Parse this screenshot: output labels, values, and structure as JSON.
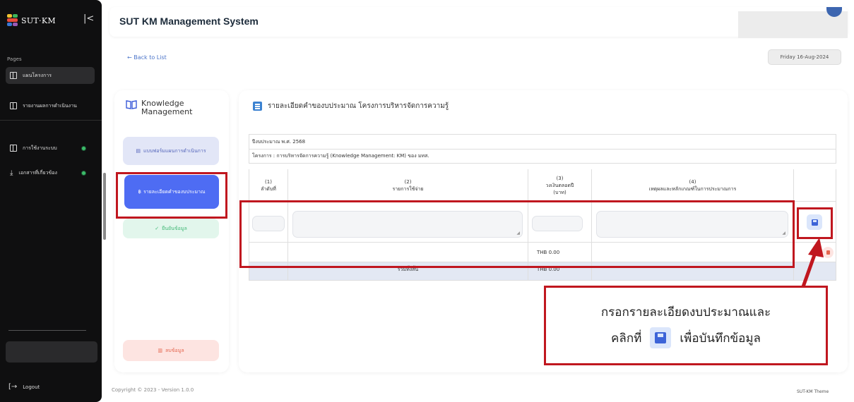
{
  "sidebar": {
    "brand": "SUT·KM",
    "collapse_glyph": "|<",
    "pages_label": "Pages",
    "items": [
      {
        "label": "แผนโครงการ",
        "icon": "table-icon"
      },
      {
        "label": "รายงานผลการดำเนินงาน",
        "icon": "document-icon"
      },
      {
        "label": "การใช้งานระบบ",
        "icon": "table-icon"
      },
      {
        "label": "เอกสารที่เกี่ยวข้อง",
        "icon": "download-icon"
      }
    ],
    "logout": "Logout"
  },
  "header": {
    "title": "SUT KM Management System"
  },
  "nav": {
    "back": "← Back to List",
    "date": "Friday 16-Aug-2024"
  },
  "left_panel": {
    "title_line1": "Knowledge",
    "title_line2": "Management",
    "form_btn": "แบบฟอร์มแผนการดำเนินการ",
    "detail_btn": "รายละเอียดคำของบประมาณ",
    "confirm_btn": "ยืนยันข้อมูล",
    "delete_btn": "ลบข้อมูล"
  },
  "main": {
    "section_title": "รายละเอียดคำของบประมาณ โครงการบริหารจัดการความรู้",
    "fiscal_year": "ปีงบประมาณ พ.ศ. 2568",
    "project": "โครงการ : การบริหารจัดการความรู้ (Knowledge Management: KM) ของ มทส.",
    "columns": [
      {
        "num": "(1)",
        "label": "ลำดับที่"
      },
      {
        "num": "(2)",
        "label": "รายการใช้จ่าย"
      },
      {
        "num": "(3)",
        "label": "วงเงินตลอดปี",
        "sub": "(บาท)"
      },
      {
        "num": "(4)",
        "label": "เหตุผลและหลักเกณฑ์ในการประมาณการ"
      }
    ],
    "row_amount": "THB 0.00",
    "total_label": "รวมทั้งสิ้น",
    "total_amount": "THB 0.00"
  },
  "callout": {
    "line1": "กรอกรายละเอียดงบประมาณและ",
    "line2_pre": "คลิกที่",
    "line2_post": "เพื่อบันทึกข้อมูล"
  },
  "footer": {
    "copyright": "Copyright © 2023 - Version 1.0.0",
    "theme": "SUT-KM Theme"
  }
}
